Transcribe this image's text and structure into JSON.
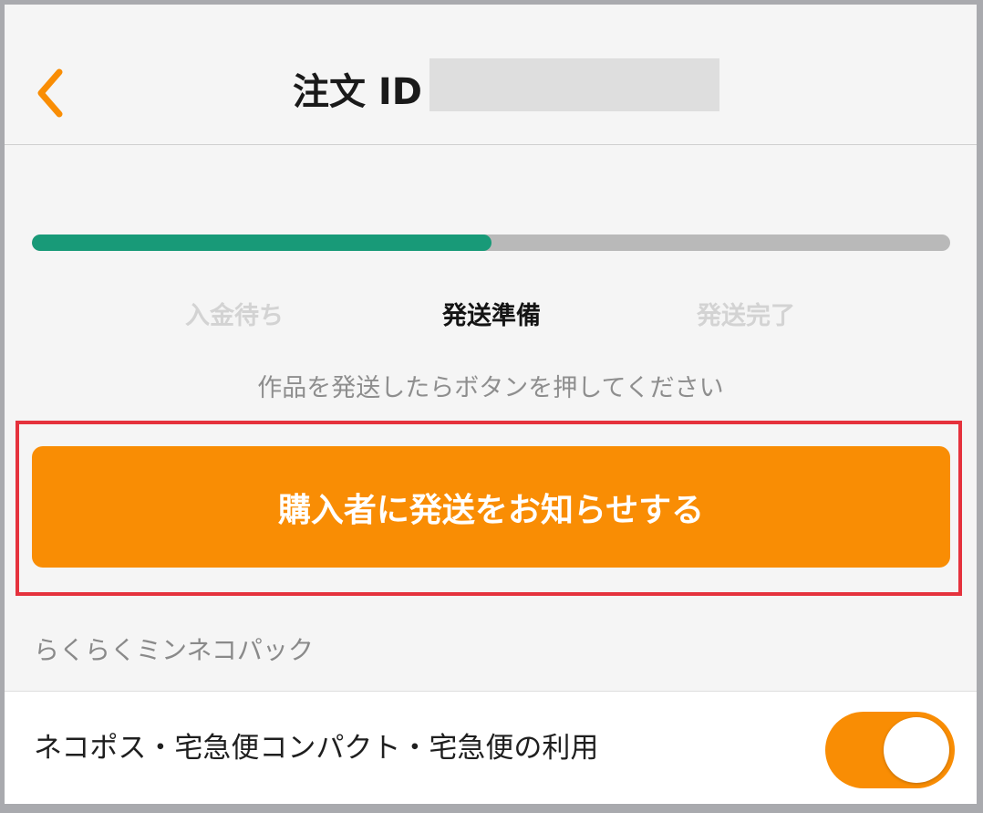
{
  "header": {
    "title": "注文 ID",
    "back_icon": "chevron-left-icon",
    "accent_color": "#f98d04"
  },
  "progress": {
    "value_percent": 50,
    "fill_color": "#189a78",
    "track_color": "#b9b9b9",
    "steps": [
      {
        "label": "入金待ち",
        "state": "done"
      },
      {
        "label": "発送準備",
        "state": "current"
      },
      {
        "label": "発送完了",
        "state": "pending"
      }
    ]
  },
  "instruction": "作品を発送したらボタンを押してください",
  "notify_button": {
    "label": "購入者に発送をお知らせする",
    "color": "#f98d04",
    "highlight_color": "#e5323d"
  },
  "shipping_section": {
    "title": "らくらくミンネコパック",
    "option_label": "ネコポス・宅急便コンパクト・宅急便の利用",
    "toggle_on": true
  }
}
